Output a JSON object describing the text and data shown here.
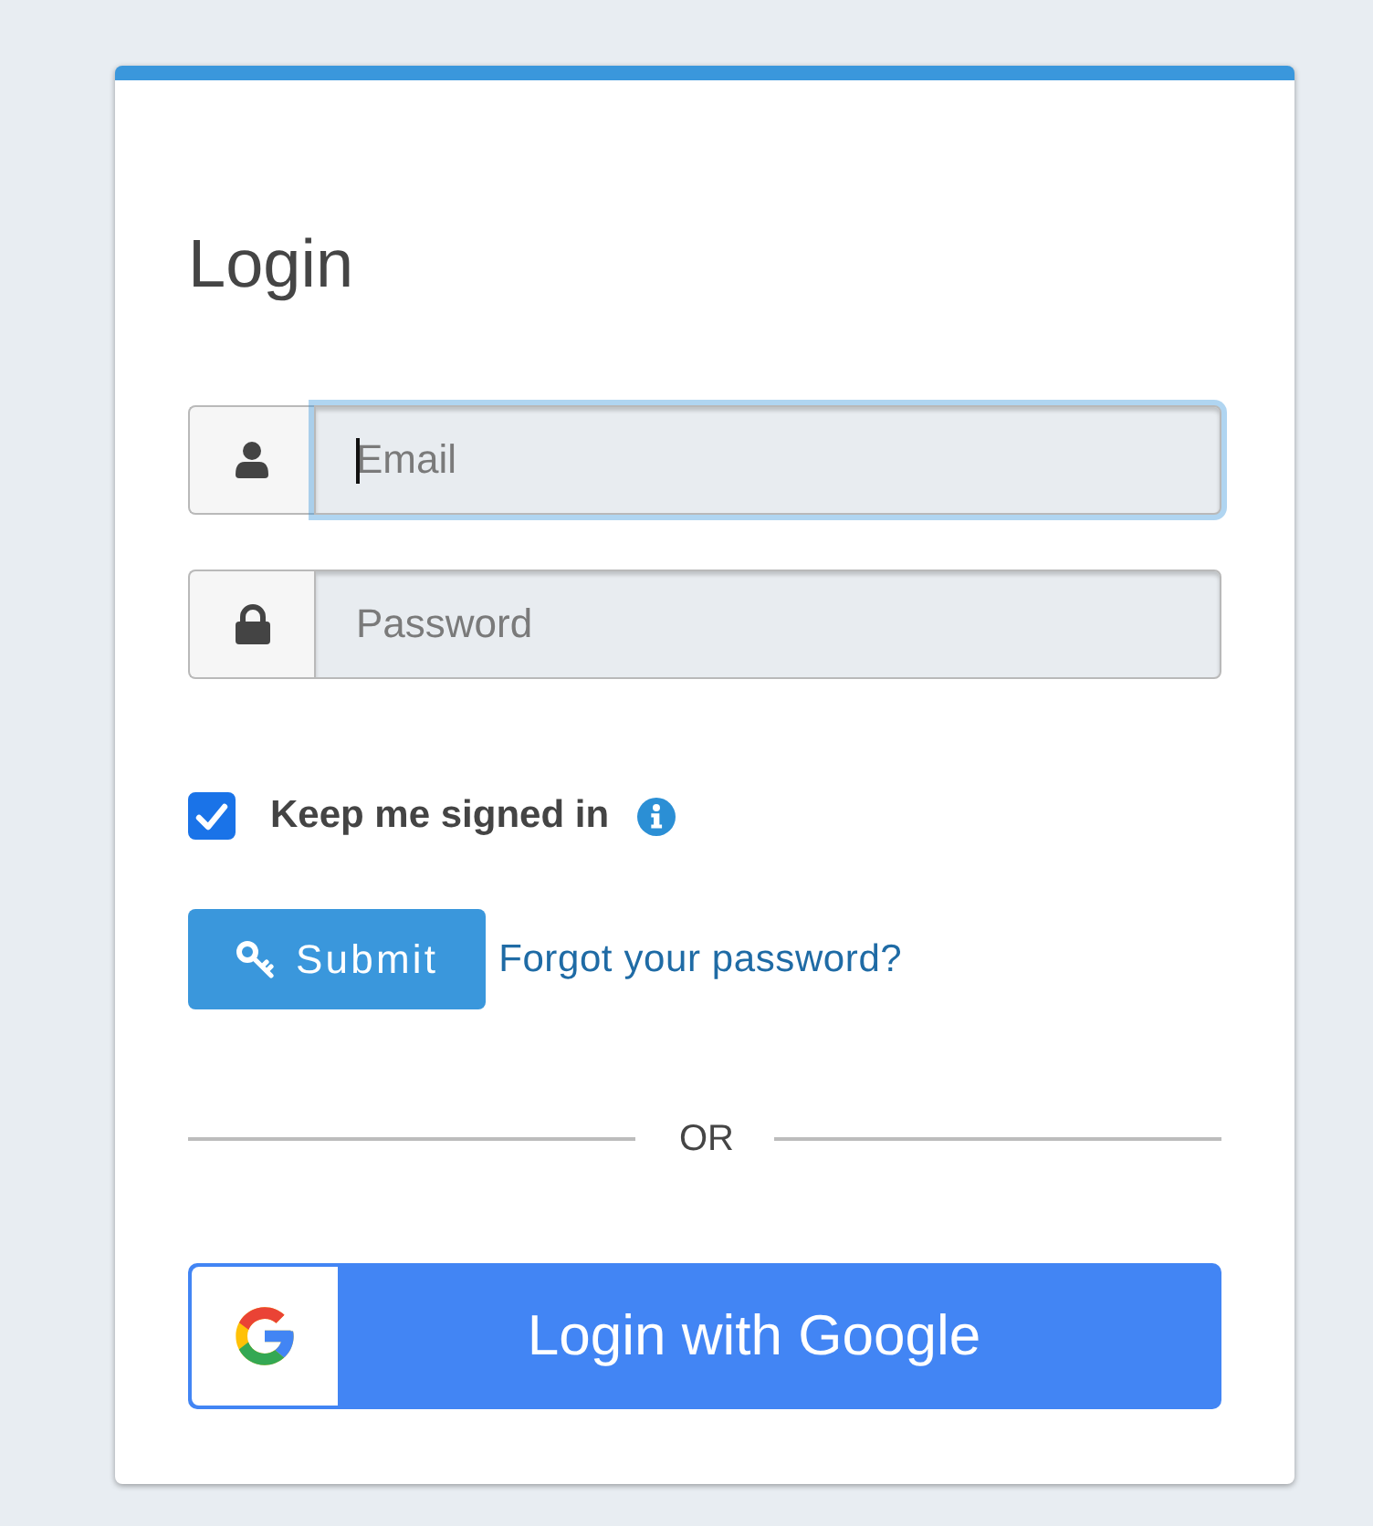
{
  "title": "Login",
  "fields": [
    {
      "kind": "email",
      "placeholder": "Email",
      "focused": true
    },
    {
      "kind": "password",
      "placeholder": "Password",
      "focused": false
    }
  ],
  "remember": {
    "label": "Keep me signed in",
    "checked": true
  },
  "submit": {
    "label": "Submit"
  },
  "forgot_link": "Forgot your password?",
  "divider": "OR",
  "google_button": {
    "label": "Login with Google"
  }
}
